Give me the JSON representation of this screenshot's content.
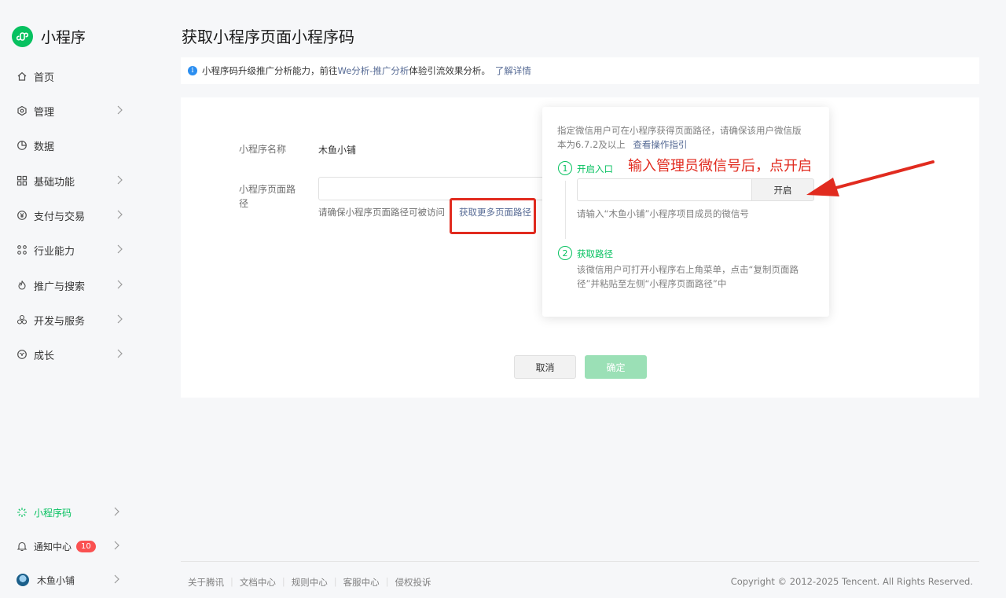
{
  "app": {
    "title": "小程序"
  },
  "nav": [
    {
      "label": "首页",
      "icon": "home-icon"
    },
    {
      "label": "管理",
      "icon": "manage-icon"
    },
    {
      "label": "数据",
      "icon": "chart-pie-icon"
    },
    {
      "label": "基础功能",
      "icon": "grid-icon"
    },
    {
      "label": "支付与交易",
      "icon": "yen-icon"
    },
    {
      "label": "行业能力",
      "icon": "industry-icon"
    },
    {
      "label": "推广与搜索",
      "icon": "flame-icon"
    },
    {
      "label": "开发与服务",
      "icon": "dev-icon"
    },
    {
      "label": "成长",
      "icon": "growth-icon"
    }
  ],
  "bottom_nav": {
    "qrcode": "小程序码",
    "notice": "通知中心",
    "notice_count": "10",
    "account": "木鱼小铺"
  },
  "page": {
    "title": "获取小程序页面小程序码"
  },
  "notice_bar": {
    "text1": "小程序码升级推广分析能力，前往",
    "link1": "We分析-推广分析",
    "text2": "体验引流效果分析。",
    "link2": "了解详情"
  },
  "form": {
    "name_label": "小程序名称",
    "name_value": "木鱼小铺",
    "path_label_1": "小程序页面路",
    "path_label_2": "径",
    "path_value": "",
    "path_hint": "请确保小程序页面路径可被访问",
    "more_paths_link": "获取更多页面路径",
    "cancel": "取消",
    "confirm": "确定"
  },
  "popover": {
    "desc_line1": "指定微信用户可在小程序获得页面路径，请确保该用户微信版",
    "desc_line2": "本为6.7.2及以上",
    "guide_link": "查看操作指引",
    "step1_num": "1",
    "step1_title": "开启入口",
    "wechat_input_value": "",
    "open_button": "开启",
    "wechat_hint": "请输入“木鱼小铺”小程序项目成员的微信号",
    "step2_num": "2",
    "step2_title": "获取路径",
    "step2_desc_line1": "该微信用户可打开小程序右上角菜单，点击“复制页面路",
    "step2_desc_line2": "径”并粘贴至左侧“小程序页面路径”中"
  },
  "annotation": {
    "text": "输入管理员微信号后，点开启",
    "color": "#e12b1f"
  },
  "footer": {
    "links": [
      "关于腾讯",
      "文档中心",
      "规则中心",
      "客服中心",
      "侵权投诉"
    ],
    "copyright": "Copyright © 2012-2025 Tencent. All Rights Reserved."
  },
  "colors": {
    "brand": "#07c160",
    "link": "#576b95",
    "danger": "#fa5151"
  }
}
